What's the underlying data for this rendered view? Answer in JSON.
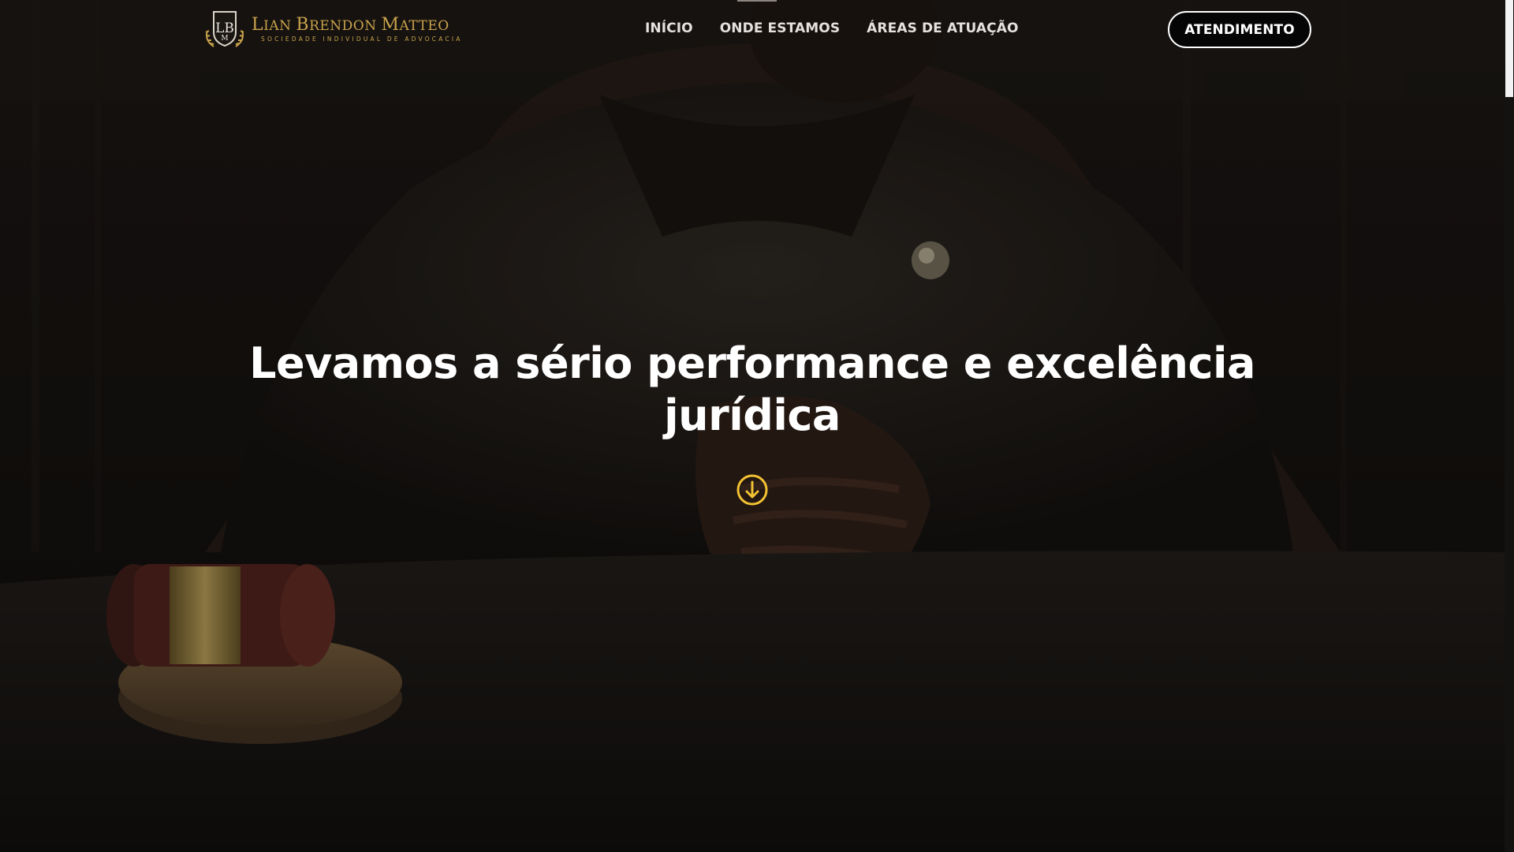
{
  "brand": {
    "name_initial_1": "L",
    "name_rest_1": "IAN ",
    "name_initial_2": "B",
    "name_rest_2": "RENDON ",
    "name_initial_3": "M",
    "name_rest_3": "ATTEO",
    "subtitle": "SOCIEDADE INDIVIDUAL DE ADVOCACIA",
    "color": "#c9a24c"
  },
  "nav": {
    "items": [
      {
        "label": "INÍCIO"
      },
      {
        "label": "ONDE ESTAMOS"
      },
      {
        "label": "ÁREAS DE ATUAÇÃO"
      }
    ]
  },
  "cta": {
    "label": "ATENDIMENTO"
  },
  "hero": {
    "headline_part1": "Levamos a sério",
    "headline_bold1": "performance",
    "headline_part2": "e",
    "headline_bold2": "excelência",
    "headline_bold3": "jurídica",
    "scroll_icon": "arrow-down-circle-icon",
    "accent_color": "#f2c233"
  }
}
